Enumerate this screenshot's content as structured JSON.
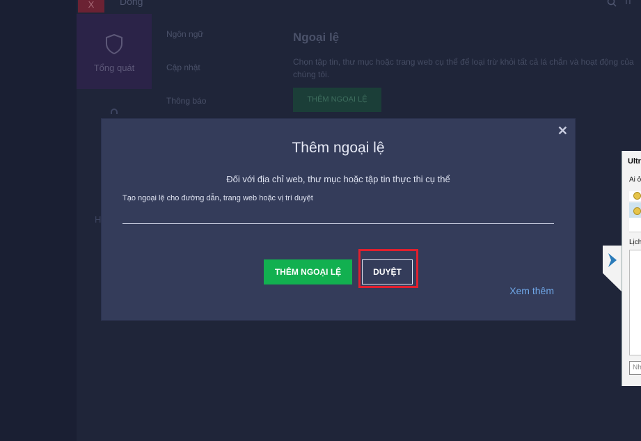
{
  "background": {
    "close_glyph": "X",
    "app_title": "Dong",
    "search_label": "Ti",
    "nav_tile_label": "Tổng quát",
    "left_text": "H",
    "settings_menu": [
      "Ngôn ngữ",
      "Cập nhật",
      "Thông báo"
    ],
    "section_title": "Ngoại lệ",
    "section_description": "Chọn tập tin, thư mục hoặc trang web cụ thể để loại trừ khỏi tất cả lá chắn và hoạt động của chúng tôi.",
    "section_button": "THÊM NGOẠI LỆ"
  },
  "modal": {
    "title": "Thêm ngoại lệ",
    "subtitle": "Đối với địa chỉ web, thư mục hoặc tập tin thực thi cụ thể",
    "field_label": "Tạo ngoại lệ cho đường dẫn, trang web hoặc vị trí duyệt",
    "field_value": "",
    "add_button": "THÊM NGOẠI LỆ",
    "browse_button": "DUYỆT",
    "more_link": "Xem thêm",
    "close_glyph": "✕"
  },
  "side_window": {
    "title": "Ultr",
    "label1": "Ai ở",
    "label2": "Lịch",
    "input_placeholder": "Nh"
  },
  "colors": {
    "modal_bg": "#343c5a",
    "add_button": "#12b050",
    "highlight": "#e0202e",
    "link": "#6fa7e8"
  }
}
